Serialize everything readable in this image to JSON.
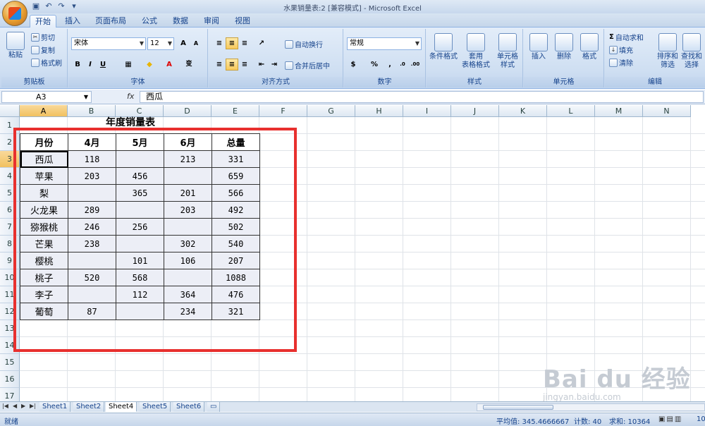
{
  "window": {
    "title": "水果销量表:2  [兼容模式] - Microsoft Excel"
  },
  "ribbon_tabs": [
    "开始",
    "插入",
    "页面布局",
    "公式",
    "数据",
    "审阅",
    "视图"
  ],
  "ribbon": {
    "clipboard": {
      "paste": "粘贴",
      "cut": "剪切",
      "copy": "复制",
      "format_painter": "格式刷",
      "label": "剪贴板"
    },
    "font": {
      "name": "宋体",
      "size": "12",
      "label": "字体"
    },
    "alignment": {
      "wrap": "自动换行",
      "merge": "合并后居中",
      "label": "对齐方式"
    },
    "number": {
      "format": "常规",
      "label": "数字"
    },
    "styles": {
      "conditional": "条件格式",
      "table_format_1": "套用",
      "table_format_2": "表格格式",
      "cell_styles_1": "单元格",
      "cell_styles_2": "样式",
      "label": "样式"
    },
    "cells": {
      "insert": "插入",
      "delete": "删除",
      "format": "格式",
      "label": "单元格"
    },
    "editing": {
      "autosum": "自动求和",
      "fill": "填充",
      "clear": "清除",
      "sort_1": "排序和",
      "sort_2": "筛选",
      "find_1": "查找和",
      "find_2": "选择",
      "label": "编辑"
    }
  },
  "formula_bar": {
    "name_box": "A3",
    "fx": "fx",
    "content": "西瓜"
  },
  "columns": [
    "A",
    "B",
    "C",
    "D",
    "E",
    "F",
    "G",
    "H",
    "I",
    "J",
    "K",
    "L",
    "M",
    "N"
  ],
  "rows": [
    "1",
    "2",
    "3",
    "4",
    "5",
    "6",
    "7",
    "8",
    "9",
    "10",
    "11",
    "12",
    "13",
    "14",
    "15",
    "16",
    "17"
  ],
  "sheet": {
    "title": "年度销量表",
    "headers": [
      "月份",
      "4月",
      "5月",
      "6月",
      "总量"
    ],
    "data": [
      [
        "西瓜",
        "118",
        "",
        "213",
        "331"
      ],
      [
        "苹果",
        "203",
        "456",
        "",
        "659"
      ],
      [
        "梨",
        "",
        "365",
        "201",
        "566"
      ],
      [
        "火龙果",
        "289",
        "",
        "203",
        "492"
      ],
      [
        "猕猴桃",
        "246",
        "256",
        "",
        "502"
      ],
      [
        "芒果",
        "238",
        "",
        "302",
        "540"
      ],
      [
        "樱桃",
        "",
        "101",
        "106",
        "207"
      ],
      [
        "桃子",
        "520",
        "568",
        "",
        "1088"
      ],
      [
        "李子",
        "",
        "112",
        "364",
        "476"
      ],
      [
        "葡萄",
        "87",
        "",
        "234",
        "321"
      ]
    ]
  },
  "sheet_tabs": [
    "Sheet1",
    "Sheet2",
    "Sheet4",
    "Sheet5",
    "Sheet6"
  ],
  "active_sheet": "Sheet4",
  "status": {
    "ready": "就绪",
    "average": "平均值: 345.4666667",
    "count": "计数: 40",
    "sum": "求和: 10364",
    "zoom": "10"
  },
  "watermark": {
    "text": "Bai du 经验",
    "sub": "jingyan.baidu.com"
  },
  "colors": {
    "accent": "#15428b",
    "highlight_box": "#e8302e",
    "table_fill": "#eceef6"
  }
}
